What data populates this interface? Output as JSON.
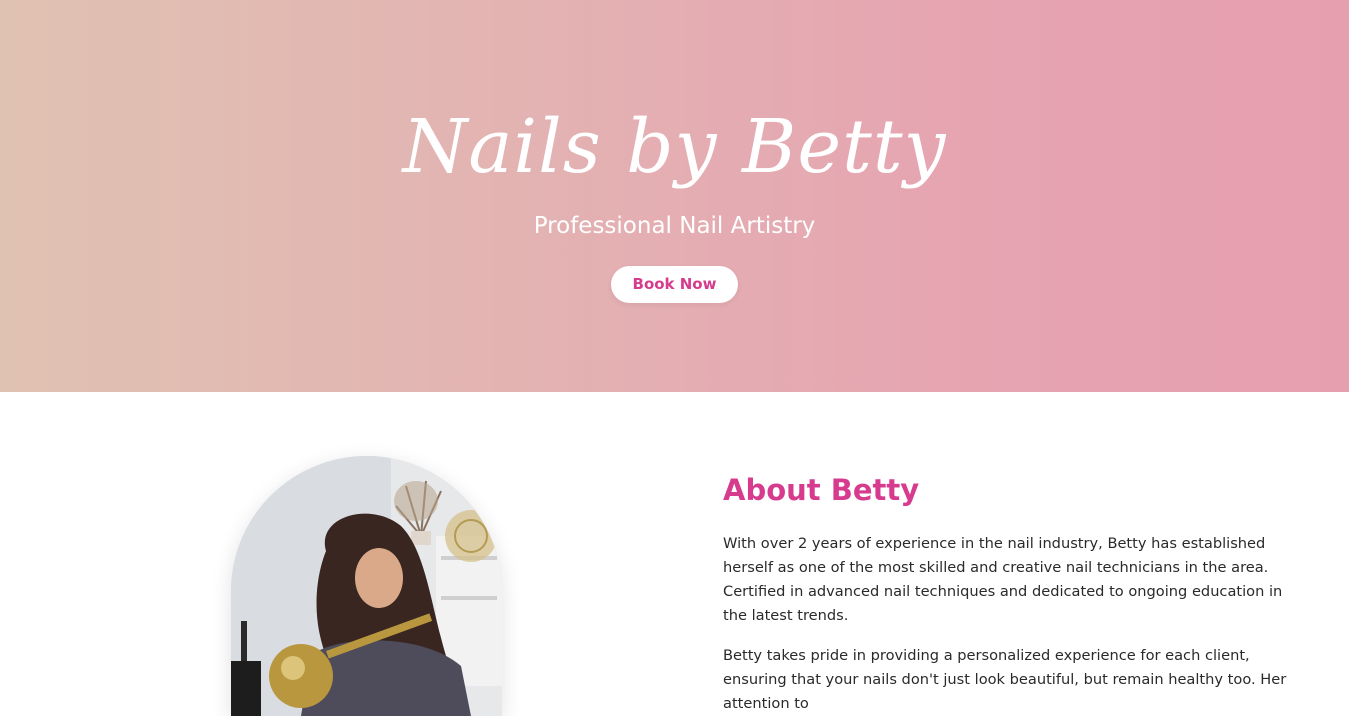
{
  "hero": {
    "title": "Nails by Betty",
    "subtitle": "Professional Nail Artistry",
    "book_label": "Book Now",
    "gradient_colors": [
      "#e0c2b2",
      "#e69faf"
    ]
  },
  "about": {
    "heading": "About Betty",
    "paragraphs": [
      "With over 2 years of experience in the nail industry, Betty has established herself as one of the most skilled and creative nail technicians in the area. Certified in advanced nail techniques and dedicated to ongoing education in the latest trends.",
      "Betty takes pride in providing a personalized experience for each client, ensuring that your nails don't just look beautiful, but remain healthy too. Her attention to"
    ]
  },
  "colors": {
    "accent": "#d63b8e",
    "body_text": "#2a2a2a",
    "hero_text": "#ffffff"
  }
}
